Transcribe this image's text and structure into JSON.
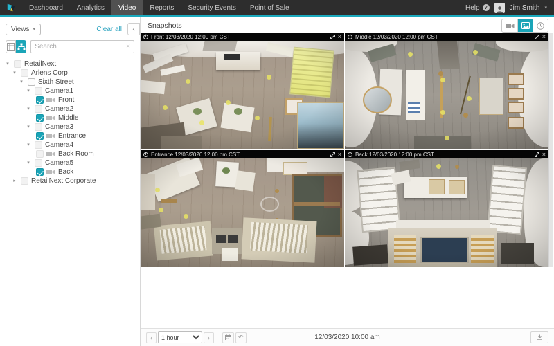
{
  "nav": {
    "items": [
      "Dashboard",
      "Analytics",
      "Video",
      "Reports",
      "Security Events",
      "Point of Sale"
    ],
    "active_item": "Video",
    "help_label": "Help",
    "user_name": "Jim Smith"
  },
  "sidebar": {
    "views_button": "Views",
    "clear_all": "Clear all",
    "search_placeholder": "Search",
    "tree": [
      {
        "label": "RetailNext",
        "level": 0,
        "expanded": true,
        "checked": false
      },
      {
        "label": "Arlens Corp",
        "level": 1,
        "expanded": true,
        "checked": false
      },
      {
        "label": "Sixth Street",
        "level": 2,
        "expanded": true,
        "checked": "partial"
      },
      {
        "label": "Camera1",
        "level": 3,
        "expanded": true,
        "checked": false
      },
      {
        "label": "Front",
        "level": 4,
        "leaf": true,
        "checked": true
      },
      {
        "label": "Camera2",
        "level": 3,
        "expanded": true,
        "checked": false
      },
      {
        "label": "Middle",
        "level": 4,
        "leaf": true,
        "checked": true
      },
      {
        "label": "Camera3",
        "level": 3,
        "expanded": true,
        "checked": false
      },
      {
        "label": "Entrance",
        "level": 4,
        "leaf": true,
        "checked": true
      },
      {
        "label": "Camera4",
        "level": 3,
        "expanded": true,
        "checked": false
      },
      {
        "label": "Back Room",
        "level": 4,
        "leaf": true,
        "checked": false
      },
      {
        "label": "Camera5",
        "level": 3,
        "expanded": true,
        "checked": false
      },
      {
        "label": "Back",
        "level": 4,
        "leaf": true,
        "checked": true
      },
      {
        "label": "RetailNext Corporate",
        "level": 1,
        "expanded": false,
        "checked": false
      }
    ]
  },
  "main": {
    "title": "Snapshots",
    "tiles": [
      {
        "name": "Front",
        "title": "Front 12/03/2020 12:00 pm CST"
      },
      {
        "name": "Middle",
        "title": "Middle 12/03/2020 12:00 pm CST"
      },
      {
        "name": "Entrance",
        "title": "Entrance 12/03/2020 12:00 pm CST"
      },
      {
        "name": "Back",
        "title": "Back 12/03/2020 12:00 pm CST"
      }
    ]
  },
  "footer": {
    "interval": "1 hour",
    "datetime": "12/03/2020 10:00 am"
  },
  "icons": {
    "expand_arrow": "▾",
    "collapse_arrow": "▸",
    "caret_down": "▾",
    "close": "×",
    "chevron_left": "‹",
    "chevron_right": "›",
    "collapse_panel": "‹",
    "undo": "↶",
    "help_mark": "?",
    "info": "i",
    "search_clear": "×"
  },
  "colors": {
    "accent": "#1aa5b8",
    "nav_bg": "#2d2d2d",
    "nav_active_bg": "#515151",
    "tile_header_bg": "#060606",
    "dot_yellow": "#e9e464"
  }
}
